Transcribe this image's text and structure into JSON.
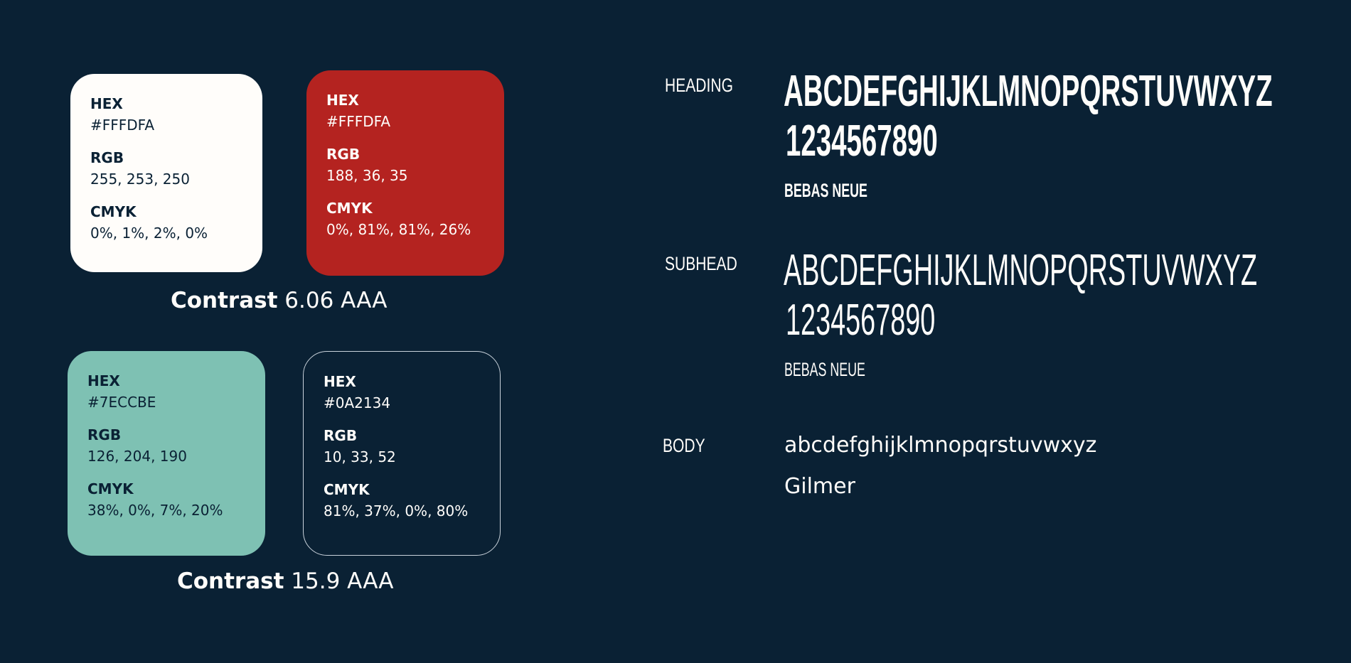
{
  "swatches": [
    {
      "hex_label": "HEX",
      "hex": "#FFFDFA",
      "rgb_label": "RGB",
      "rgb": "255, 253, 250",
      "cmyk_label": "CMYK",
      "cmyk": "0%, 1%, 2%, 0%",
      "background": "#FFFDFA",
      "text_color": "#0A2134"
    },
    {
      "hex_label": "HEX",
      "hex": "#FFFDFA",
      "rgb_label": "RGB",
      "rgb": "188, 36, 35",
      "cmyk_label": "CMYK",
      "cmyk": "0%, 81%, 81%, 26%",
      "background": "#B42320",
      "text_color": "#FFFDFA"
    },
    {
      "hex_label": "HEX",
      "hex": "#7ECCBE",
      "rgb_label": "RGB",
      "rgb": "126, 204, 190",
      "cmyk_label": "CMYK",
      "cmyk": "38%, 0%, 7%, 20%",
      "background": "#7EC1B3",
      "text_color": "#0A2134"
    },
    {
      "hex_label": "HEX",
      "hex": "#0A2134",
      "rgb_label": "RGB",
      "rgb": "10, 33, 52",
      "cmyk_label": "CMYK",
      "cmyk": "81%, 37%, 0%, 80%",
      "background": "#0A2134",
      "text_color": "#FFFDFA"
    }
  ],
  "contrasts": [
    {
      "label": "Contrast",
      "value": "6.06 AAA"
    },
    {
      "label": "Contrast",
      "value": "15.9 AAA"
    }
  ],
  "typography": {
    "heading": {
      "label": "HEADING",
      "letters": "ABCDEFGHIJKLMNOPQRSTUVWXYZ",
      "numbers": "1234567890",
      "font_name": "BEBAS NEUE"
    },
    "subhead": {
      "label": "SUBHEAD",
      "letters": "ABCDEFGHIJKLMNOPQRSTUVWXYZ",
      "numbers": "1234567890",
      "font_name": "BEBAS NEUE"
    },
    "body": {
      "label": "BODY",
      "alphabet": "abcdefghijklmnopqrstuvwxyz",
      "font_name": "Gilmer"
    }
  },
  "colors": {
    "page_background": "#0A2134",
    "text_light": "#FFFDFA"
  }
}
